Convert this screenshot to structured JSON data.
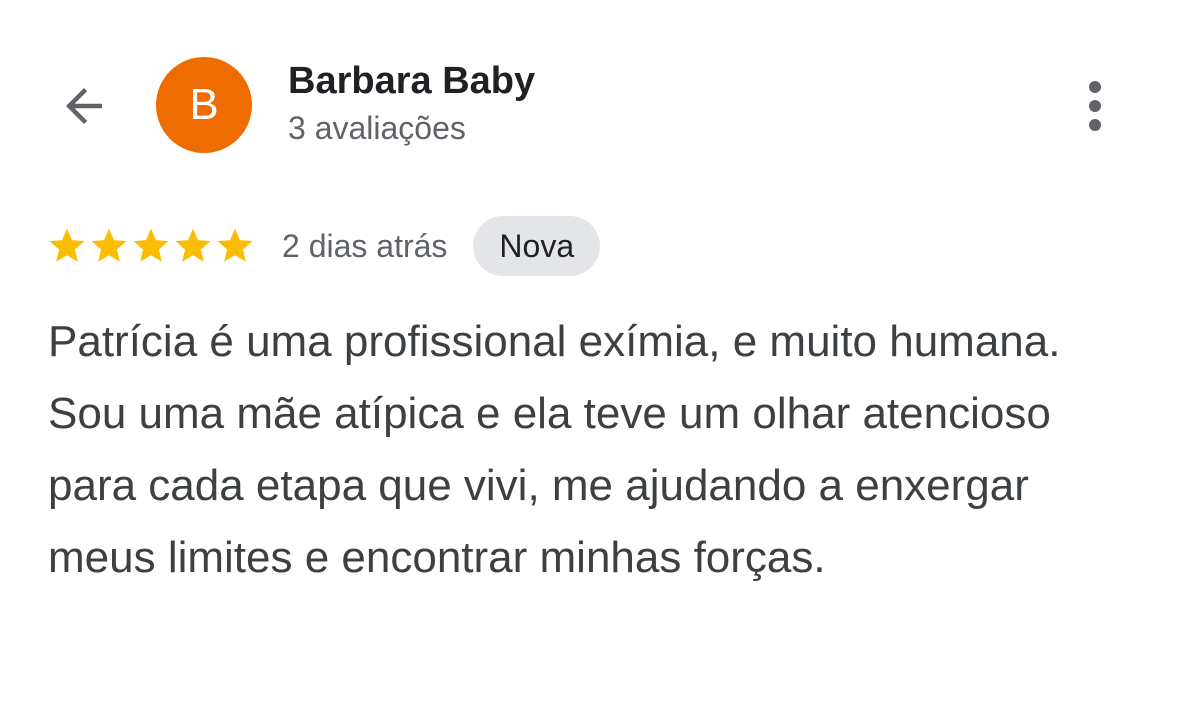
{
  "header": {
    "back_icon": "arrow-back-icon",
    "more_icon": "more-vert-icon"
  },
  "reviewer": {
    "initial": "B",
    "avatar_color": "#EF6C00",
    "name": "Barbara Baby",
    "review_count": "3 avaliações"
  },
  "review": {
    "rating": 5,
    "max_rating": 5,
    "star_color": "#FBBC04",
    "date": "2 dias atrás",
    "badge": "Nova",
    "text": "Patrícia é uma profissional exímia, e muito humana. Sou uma mãe atípica e ela teve um olhar atencioso para cada etapa que vivi, me ajudando a enxergar meus limites e encontrar minhas forças."
  }
}
